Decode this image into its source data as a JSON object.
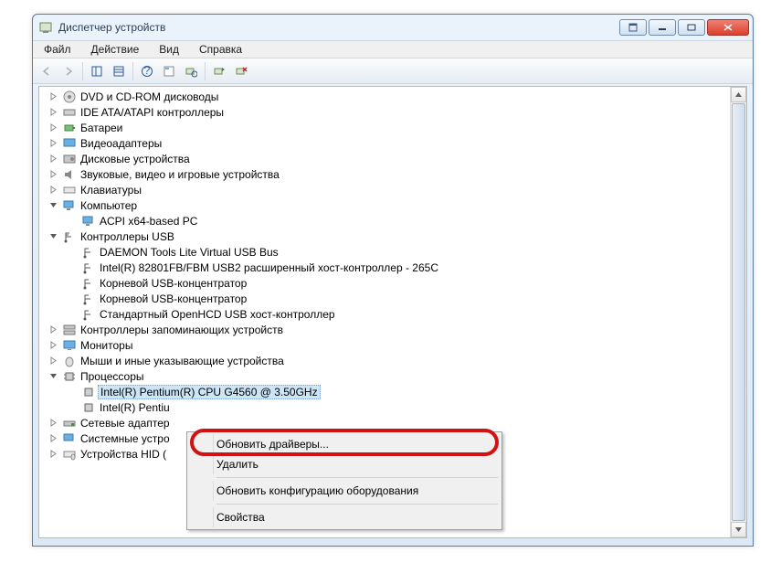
{
  "window": {
    "title": "Диспетчер устройств"
  },
  "menu": {
    "file": "Файл",
    "action": "Действие",
    "view": "Вид",
    "help": "Справка"
  },
  "tree": {
    "dvd": "DVD и CD-ROM дисководы",
    "ide": "IDE ATA/ATAPI контроллеры",
    "battery": "Батареи",
    "video": "Видеоадаптеры",
    "disk": "Дисковые устройства",
    "sound": "Звуковые, видео и игровые устройства",
    "keyboard": "Клавиатуры",
    "computer": "Компьютер",
    "acpi": "ACPI x64-based PC",
    "usb": "Контроллеры USB",
    "usb1": "DAEMON Tools Lite Virtual USB Bus",
    "usb2": "Intel(R) 82801FB/FBM USB2 расширенный хост-контроллер - 265C",
    "usb3": "Корневой USB-концентратор",
    "usb4": "Корневой USB-концентратор",
    "usb5": "Стандартный OpenHCD USB хост-контроллер",
    "storage": "Контроллеры запоминающих устройств",
    "monitors": "Мониторы",
    "mice": "Мыши и иные указывающие устройства",
    "processors": "Процессоры",
    "cpu1": "Intel(R) Pentium(R) CPU G4560 @ 3.50GHz",
    "cpu2": "Intel(R) Pentiu",
    "network": "Сетевые адаптер",
    "system": "Системные устро",
    "hid": "Устройства HID ("
  },
  "context_menu": {
    "update": "Обновить драйверы...",
    "delete": "Удалить",
    "refresh": "Обновить конфигурацию оборудования",
    "properties": "Свойства"
  }
}
